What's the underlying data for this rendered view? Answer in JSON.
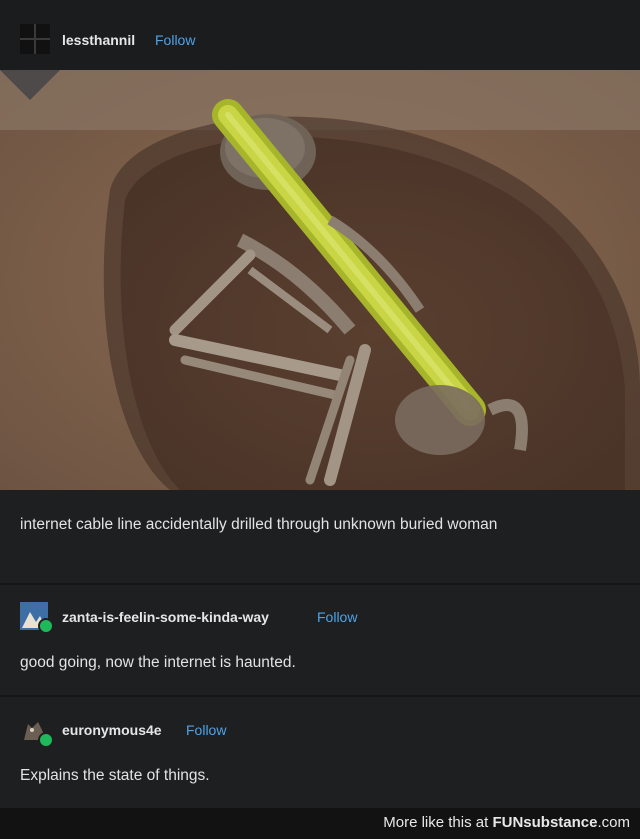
{
  "post": {
    "username": "lessthannil",
    "follow_label": "Follow",
    "caption": "internet cable line accidentally drilled through unknown buried woman"
  },
  "replies": [
    {
      "username": "zanta-is-feelin-some-kinda-way",
      "follow_label": "Follow",
      "text": "good going, now the internet is haunted."
    },
    {
      "username": "euronymous4e",
      "follow_label": "Follow",
      "text": "Explains the state of things."
    }
  ],
  "footer": {
    "prefix": "More like this at ",
    "brand": "FUNsubstance",
    "suffix": ".com"
  },
  "colors": {
    "accent": "#4ea3e8",
    "background": "#1e1f21",
    "badge": "#1fb85a"
  },
  "icons": [
    "grid-avatar-icon",
    "landscape-avatar-icon",
    "cat-avatar-icon",
    "badge-icon"
  ]
}
